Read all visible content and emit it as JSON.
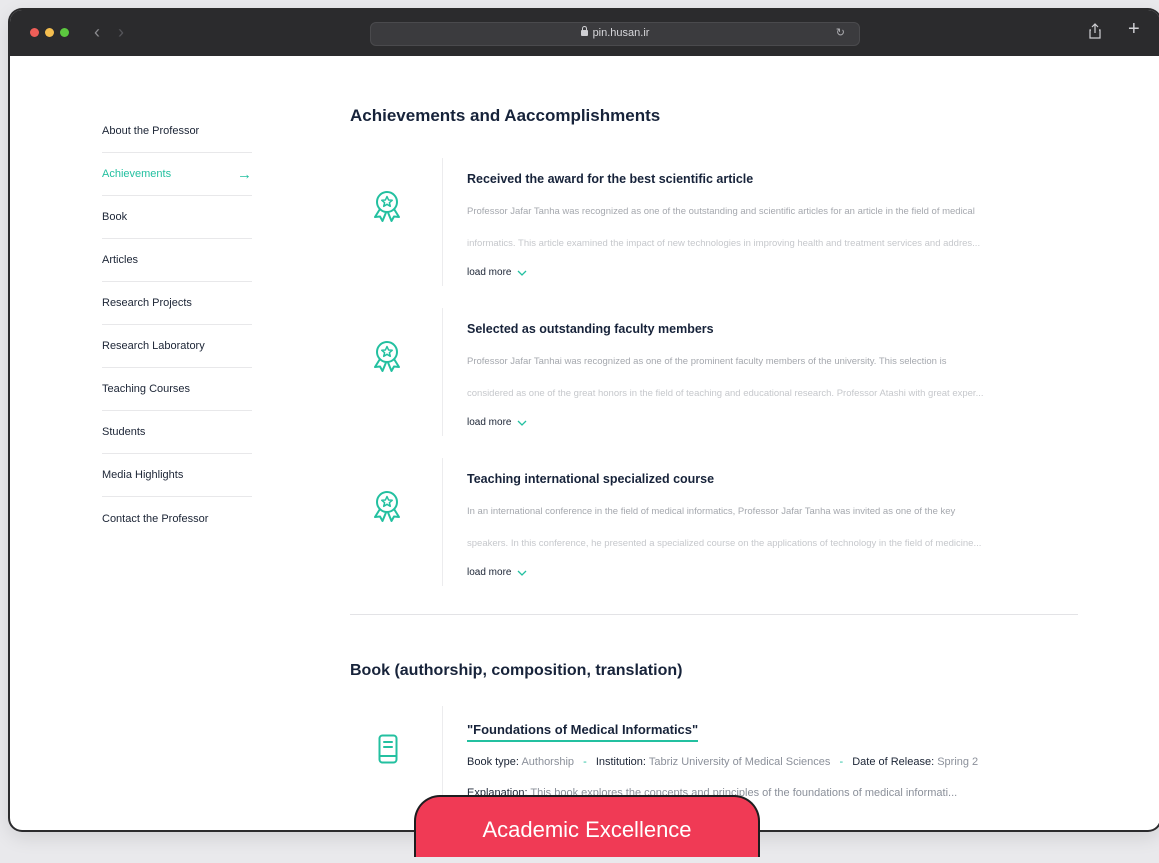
{
  "browser": {
    "url": "pin.husan.ir"
  },
  "sidebar": {
    "items": [
      {
        "label": "About the Professor"
      },
      {
        "label": "Achievements"
      },
      {
        "label": "Book"
      },
      {
        "label": "Articles"
      },
      {
        "label": "Research Projects"
      },
      {
        "label": "Research Laboratory"
      },
      {
        "label": "Teaching Courses"
      },
      {
        "label": "Students"
      },
      {
        "label": "Media Highlights"
      },
      {
        "label": "Contact the Professor"
      }
    ],
    "active_index": 1
  },
  "achievements": {
    "title": "Achievements and Aaccomplishments",
    "load_more": "load more",
    "items": [
      {
        "title": "Received the award for the best scientific article",
        "line1": "Professor Jafar Tanha was recognized as one of the outstanding and scientific articles for an article in the field of medical",
        "line2": "informatics. This article examined the impact of new technologies in improving health and treatment services and addres..."
      },
      {
        "title": "Selected as outstanding faculty members",
        "line1": "Professor Jafar Tanhai was recognized as one of the prominent faculty members of the university. This selection is",
        "line2": "considered as one of the great honors in the field of teaching and educational research. Professor Atashi with great exper..."
      },
      {
        "title": "Teaching international specialized course",
        "line1": "In an international conference in the field of medical informatics, Professor Jafar Tanha was invited as one of the key",
        "line2": "speakers. In this conference, he presented a specialized course on the applications of technology in the field of medicine..."
      }
    ]
  },
  "books": {
    "title": "Book (authorship, composition, translation)",
    "items": [
      {
        "name": "\"Foundations of Medical Informatics\"",
        "type_label": "Book type:",
        "type": "Authorship",
        "institution_label": "Institution:",
        "institution": "Tabriz University of Medical Sciences",
        "date_label": "Date of Release:",
        "date": "Spring 2",
        "separator": "-",
        "explanation_label": "Explanation:",
        "explanation": "This book explores the concepts and principles of the foundations of medical informati..."
      }
    ]
  },
  "badge": {
    "label": "Academic Excellence"
  },
  "colors": {
    "accent": "#23c0a0",
    "heading": "#17233a",
    "badge": "#f03a55",
    "titlebar": "#2b2b2d"
  },
  "icons": {
    "achievement": "award-ribbon-icon",
    "book": "book-icon",
    "load_more": "chevron-down-icon",
    "active_nav": "arrow-right-icon"
  }
}
